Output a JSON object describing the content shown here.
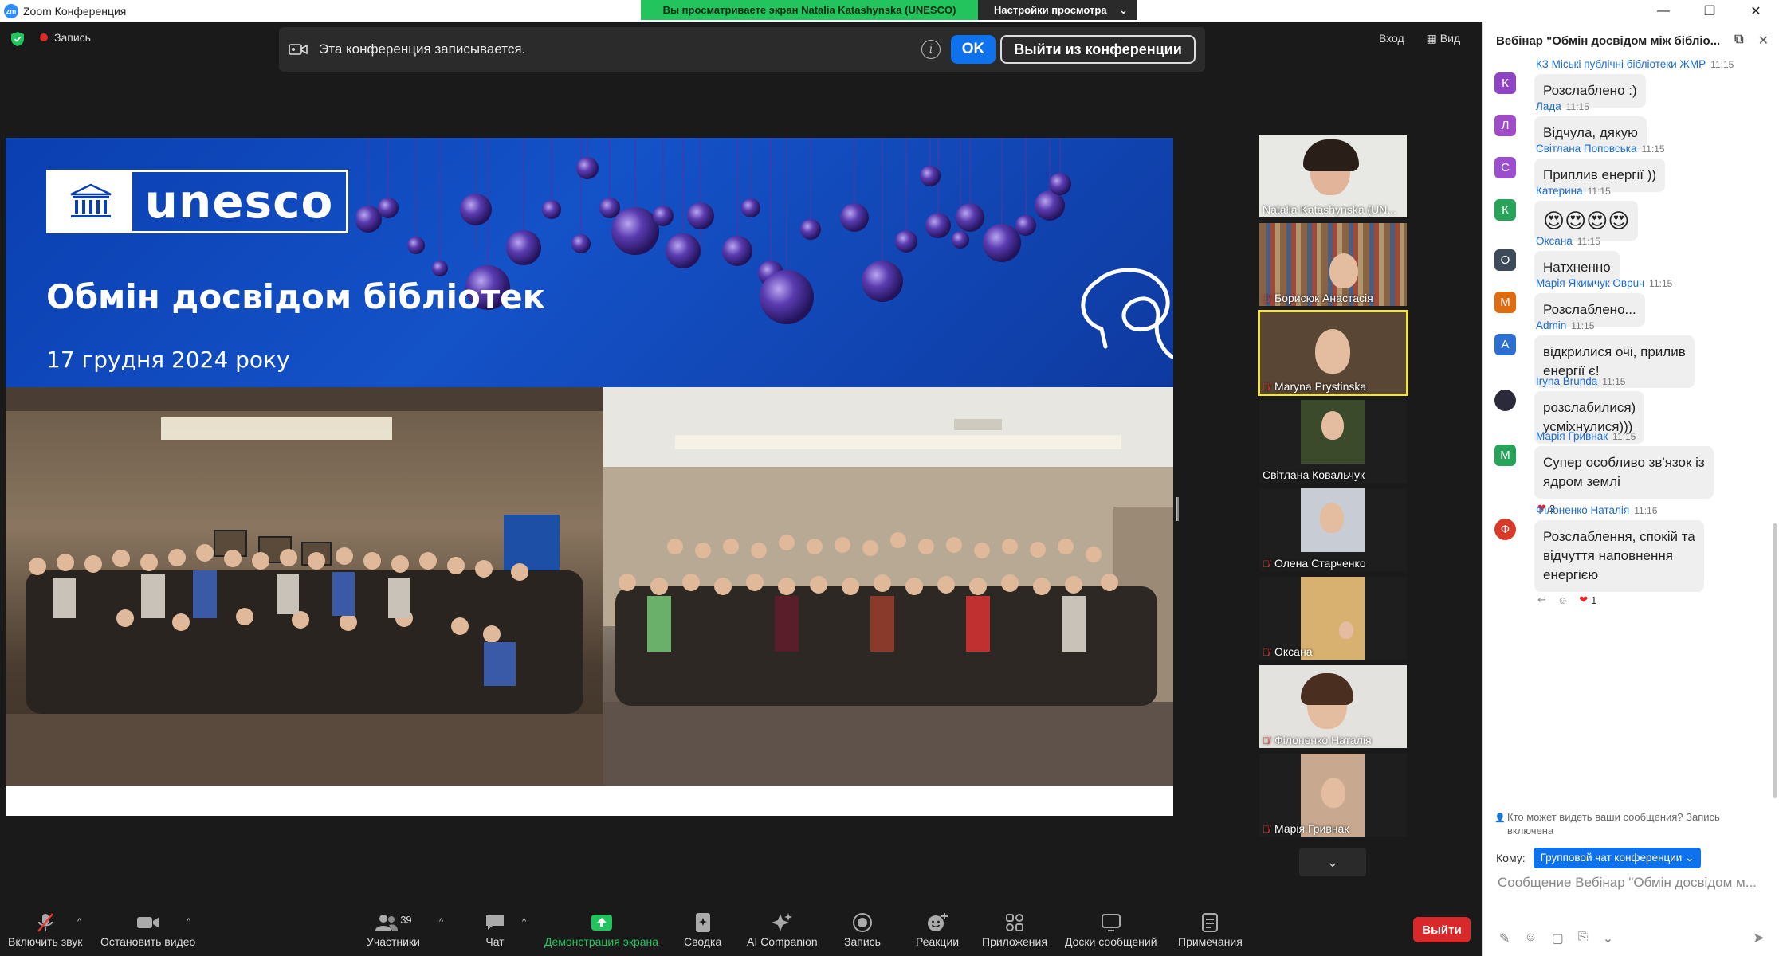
{
  "window": {
    "title": "Zoom Конференция",
    "logo": "zm",
    "viewing_banner": "Вы просматриваете экран Natalia Katashynska (UNESCO)",
    "view_settings": "Настройки просмотра"
  },
  "top": {
    "recording_label": "Запись",
    "recording_notice": "Эта конференция записывается.",
    "ok_label": "OK",
    "leave_conference_label": "Выйти из конференции",
    "enter_label": "Вход",
    "view_label": "Вид"
  },
  "slide": {
    "logo_text": "unesco",
    "title": "Обмін досвідом бібліотек",
    "date": "17 грудня 2024 року"
  },
  "participants": [
    {
      "name": "Natalia Katashynska (UN...",
      "muted": false,
      "active": false
    },
    {
      "name": "Борисюк Анастасія",
      "muted": true,
      "active": false
    },
    {
      "name": "Maryna Prystinska",
      "muted": true,
      "active": true
    },
    {
      "name": "Світлана Ковальчук",
      "muted": false,
      "active": false
    },
    {
      "name": "Олена Старченко",
      "muted": true,
      "active": false
    },
    {
      "name": "Оксана",
      "muted": true,
      "active": false
    },
    {
      "name": "Філоненко Наталія",
      "muted": true,
      "active": false
    },
    {
      "name": "Марія Гривнак",
      "muted": true,
      "active": false
    }
  ],
  "toolbar": {
    "unmute": "Включить звук",
    "stop_video": "Остановить видео",
    "participants": "Участники",
    "participants_count": "39",
    "chat": "Чат",
    "share_screen": "Демонстрация экрана",
    "summary": "Сводка",
    "ai_companion": "AI Companion",
    "record": "Запись",
    "reactions": "Реакции",
    "apps": "Приложения",
    "whiteboards": "Доски сообщений",
    "notes": "Примечания",
    "leave": "Выйти"
  },
  "chat": {
    "title": "Вебінар \"Обмін досвідом між бібліо...",
    "messages": [
      {
        "initial": "К",
        "color": "#8e44c4",
        "sender": "КЗ Міські публічні бібліотеки ЖМР",
        "time": "11:15",
        "lines": [
          "Розслаблено :)"
        ]
      },
      {
        "initial": "Л",
        "color": "#a04cc8",
        "sender": "Лада",
        "time": "11:15",
        "lines": [
          "Відчула, дякую"
        ]
      },
      {
        "initial": "С",
        "color": "#9b4fcf",
        "sender": "Світлана Поповська",
        "time": "11:15",
        "lines": [
          "Приплив енергії ))"
        ]
      },
      {
        "initial": "К",
        "color": "#27a35a",
        "sender": "Катерина",
        "time": "11:15",
        "lines": [
          "😍😍😍😍"
        ]
      },
      {
        "initial": "О",
        "color": "#3d4a5a",
        "sender": "Оксана",
        "time": "11:15",
        "lines": [
          "Натхненно"
        ]
      },
      {
        "initial": "М",
        "color": "#e06c12",
        "sender": "Марія Якимчук Оврuч",
        "time": "11:15",
        "lines": [
          "Розслаблено..."
        ]
      },
      {
        "initial": "A",
        "color": "#2d6fd1",
        "sender": "Admin",
        "time": "11:15",
        "lines": [
          "відкрилися очі, прилив",
          "енергії є!"
        ]
      },
      {
        "initial": "",
        "color": "#2a2a3a",
        "sender": "Iryna Brunda",
        "time": "11:15",
        "lines": [
          "розслабилися)",
          "усміхнулися)))"
        ]
      },
      {
        "initial": "М",
        "color": "#27a35a",
        "sender": "Марія Гривнак",
        "time": "11:15",
        "lines": [
          "Супер особливо зв'язок із",
          "ядром землі"
        ],
        "reaction": "2"
      },
      {
        "initial": "Ф",
        "color": "#d83a2a",
        "sender": "Філоненко Наталія",
        "time": "11:16",
        "lines": [
          "Розслаблення, спокій та",
          "відчуття наповнення",
          "енергією"
        ],
        "reaction": "1"
      }
    ],
    "who_sees": "Кто может видеть ваши сообщения? Запись включена",
    "to_label": "Кому:",
    "to_value": "Групповой чат конференции",
    "placeholder": "Сообщение Вебінар \"Обмін досвідом м..."
  }
}
